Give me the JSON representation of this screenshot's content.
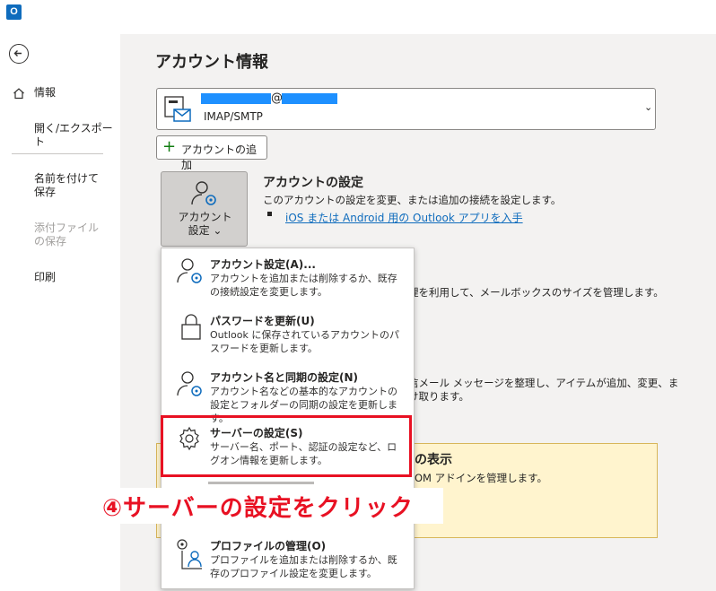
{
  "app": {
    "icon_letter": "O"
  },
  "nav": {
    "items": [
      {
        "label": "情報"
      },
      {
        "label": "開く/エクスポート"
      },
      {
        "label": "名前を付けて保存"
      },
      {
        "label": "添付ファイルの保存"
      },
      {
        "label": "印刷"
      }
    ]
  },
  "main": {
    "title": "アカウント情報",
    "account": {
      "at": "@",
      "type": "IMAP/SMTP",
      "chevron": "⌄"
    },
    "add_account_label": "アカウントの追加",
    "settings_button_label": "アカウント\n設定 ⌄",
    "settings_section": {
      "title": "アカウントの設定",
      "description": "このアカウントの設定を変更、または追加の接続を設定します。",
      "link": "iOS または Android 用の Outlook アプリを入手"
    },
    "mailbox_fragment": "理を利用して、メールボックスのサイズを管理します。",
    "rules_fragment_1": "信メール メッセージを整理し、アイテムが追加、変更、ま",
    "rules_fragment_2": "け取ります。",
    "addins": {
      "title": "の表示",
      "description": "OM アドインを管理します。"
    }
  },
  "menu": {
    "items": [
      {
        "title": "アカウント設定(A)...",
        "description": "アカウントを追加または削除するか、既存の接続設定を変更します。",
        "icon": "account-gear-icon"
      },
      {
        "title": "パスワードを更新(U)",
        "description": "Outlook に保存されているアカウントのパスワードを更新します。",
        "icon": "lock-icon"
      },
      {
        "title": "アカウント名と同期の設定(N)",
        "description": "アカウント名などの基本的なアカウントの設定とフォルダーの同期の設定を更新します。",
        "icon": "account-gear-icon"
      },
      {
        "title": "サーバーの設定(S)",
        "description": "サーバー名、ポート、認証の設定など、ログオン情報を更新します。",
        "icon": "gear-icon"
      },
      {
        "title": "プロファイルの管理(O)",
        "description": "プロファイルを追加または削除するか、既存のプロファイル設定を変更します。",
        "icon": "profile-gear-icon"
      }
    ]
  },
  "annotation": {
    "text": "④サーバーの設定をクリック"
  },
  "colors": {
    "accent": "#0f6cbd",
    "highlight": "#e81123",
    "banner": "#fff4ce"
  }
}
